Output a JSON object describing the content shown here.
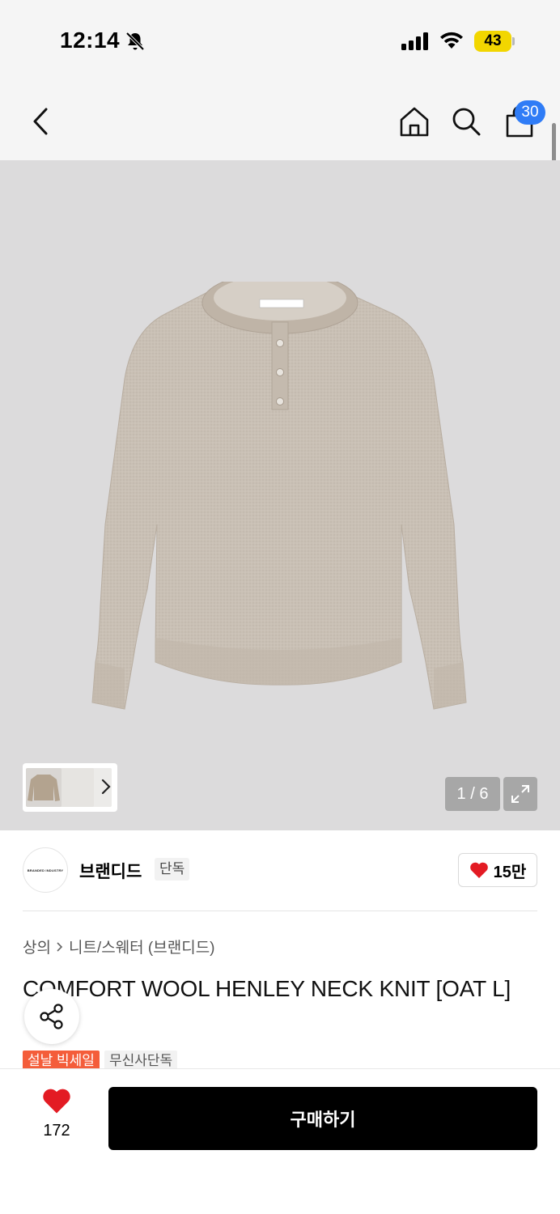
{
  "status_bar": {
    "time": "12:14",
    "battery": "43"
  },
  "nav": {
    "cart_count": "30"
  },
  "gallery": {
    "counter": "1 / 6"
  },
  "brand": {
    "name": "브랜디드",
    "tag": "단독",
    "likes": "15만",
    "logo_text": "BRANDED INDUSTRY"
  },
  "breadcrumb": {
    "category": "상의",
    "subcategory": "니트/스웨터 (브랜디드)"
  },
  "product": {
    "title": "COMFORT WOOL HENLEY NECK KNIT [OAT L]",
    "chips": [
      "설날 빅세일",
      "무신사단독"
    ]
  },
  "bottom": {
    "like_count": "172",
    "buy_label": "구매하기"
  },
  "colors": {
    "accent_blue": "#2f7cf6",
    "heart_red": "#e31b23",
    "sale_orange": "#f45d3a",
    "battery_yellow": "#f2d600"
  }
}
